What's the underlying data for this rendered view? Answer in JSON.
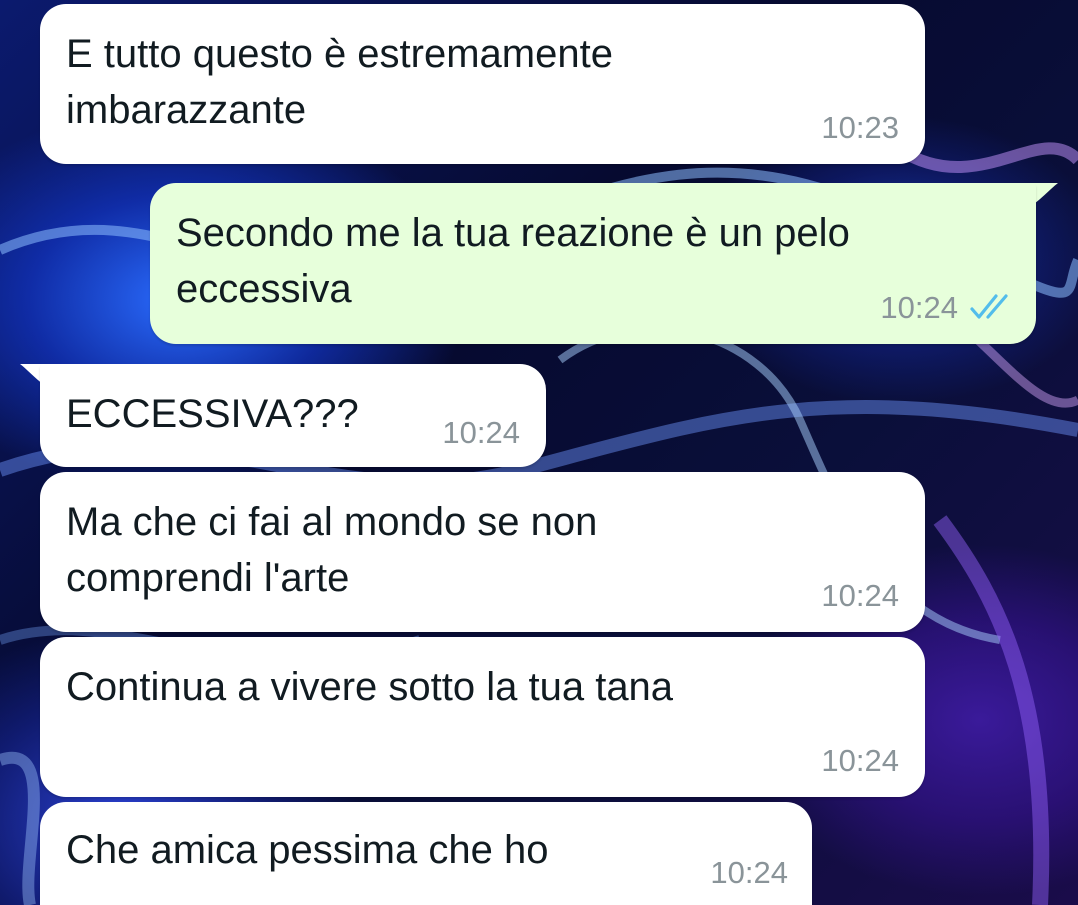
{
  "messages": [
    {
      "direction": "in",
      "text": "E tutto questo è estremamente\nimbarazzante",
      "time": "10:23"
    },
    {
      "direction": "out",
      "text": "Secondo me la tua reazione è un pelo\neccessiva",
      "time": "10:24",
      "status": "read-double-check-icon"
    },
    {
      "direction": "in",
      "text": "ECCESSIVA???",
      "time": "10:24"
    },
    {
      "direction": "in",
      "text": "Ma che ci fai al mondo se non\ncomprendi l'arte",
      "time": "10:24"
    },
    {
      "direction": "in",
      "text": "Continua a vivere sotto la tua tana",
      "time": "10:24"
    },
    {
      "direction": "in",
      "text": "Che amica pessima che ho",
      "time": "10:24"
    }
  ],
  "colors": {
    "incoming_bubble": "#ffffff",
    "outgoing_bubble": "#e7ffdb",
    "text": "#111b21",
    "timestamp": "#8a9499",
    "read_ticks": "#53bdeb"
  }
}
